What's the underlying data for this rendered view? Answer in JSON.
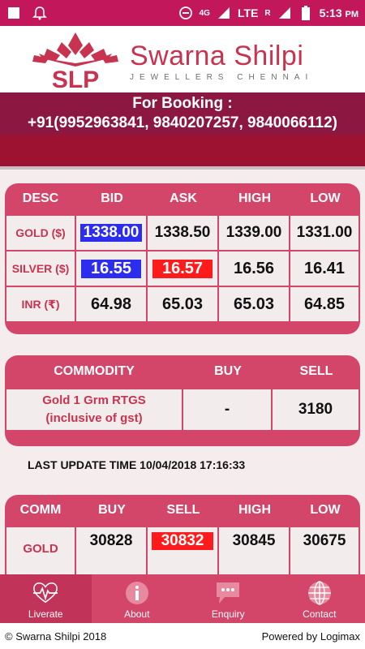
{
  "status_bar": {
    "time": "5:13",
    "ampm": "PM",
    "network_4g": "4G",
    "network_lte": "LTE",
    "roaming": "R"
  },
  "brand": {
    "name": "Swarna Shilpi",
    "tagline": "JEWELLERS CHENNAI",
    "logo_text": "SLP",
    "color": "#c8334f"
  },
  "booking": {
    "title": "For Booking :",
    "phones": "+91(9952963841, 9840207257, 9840066112)"
  },
  "rates_table": {
    "headers": [
      "DESC",
      "BID",
      "ASK",
      "HIGH",
      "LOW"
    ],
    "rows": [
      {
        "desc": "GOLD ($)",
        "bid": "1338.00",
        "ask": "1338.50",
        "high": "1339.00",
        "low": "1331.00"
      },
      {
        "desc": "SILVER ($)",
        "bid": "16.55",
        "ask": "16.57",
        "high": "16.56",
        "low": "16.41"
      },
      {
        "desc": "INR (₹)",
        "bid": "64.98",
        "ask": "65.03",
        "high": "65.03",
        "low": "64.85"
      }
    ]
  },
  "commodity_table": {
    "headers": [
      "COMMODITY",
      "BUY",
      "SELL"
    ],
    "rows": [
      {
        "commodity_line1": "Gold 1 Grm RTGS",
        "commodity_line2": "(inclusive of gst)",
        "buy": "-",
        "sell": "3180"
      }
    ]
  },
  "last_update": "LAST UPDATE TIME 10/04/2018 17:16:33",
  "comm_table": {
    "headers": [
      "COMM",
      "BUY",
      "SELL",
      "HIGH",
      "LOW"
    ],
    "rows": [
      {
        "comm": "GOLD",
        "buy": "30828",
        "sell": "30832",
        "high": "30845",
        "low": "30675"
      }
    ]
  },
  "bottom_nav": {
    "items": [
      {
        "label": "Liverate",
        "icon": "pulse-heart-icon"
      },
      {
        "label": "About",
        "icon": "info-icon"
      },
      {
        "label": "Enquiry",
        "icon": "chat-bubble-icon"
      },
      {
        "label": "Contact",
        "icon": "globe-icon"
      }
    ]
  },
  "footer": {
    "copyright": "© Swarna Shilpi 2018",
    "powered_by": "Powered by Logimax"
  },
  "colors": {
    "accent": "#d4456a",
    "dark_accent": "#8c1741",
    "bid_highlight": "#2d2df0",
    "ask_highlight": "#ff1b1b"
  }
}
